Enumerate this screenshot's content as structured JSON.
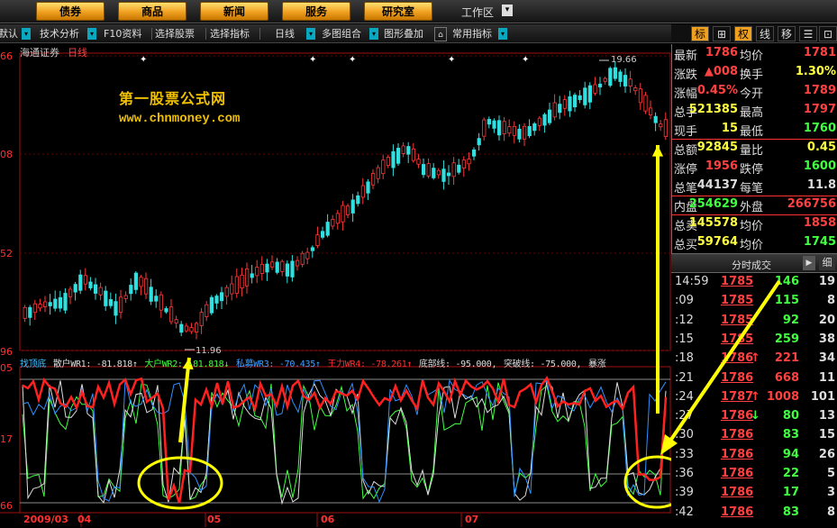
{
  "menu": [
    "债券",
    "商品",
    "新闻",
    "服务",
    "研究室"
  ],
  "workspace": "工作区",
  "workspace_arrow": "▾",
  "toolbar": {
    "left_cut": "默认",
    "tech": "技术分析",
    "f10": "F10资料",
    "choose_stock": "选择股票",
    "choose_indicator": "选择指标",
    "period": "日线",
    "multi": "多图组合",
    "overlay": "图形叠加",
    "common": "常用指标",
    "arrow": "▾"
  },
  "right_tools": [
    "标",
    "⊞",
    "权",
    "线",
    "移",
    "☰",
    "⊡"
  ],
  "chart": {
    "stock_name": "海通证券",
    "period": "日线",
    "watermark_title": "第一股票公式网",
    "watermark_url": "www.chnmoney.com",
    "price_labels": [
      "66",
      "08",
      "52",
      "96"
    ],
    "high_label": "19.66",
    "low_label": "11.96",
    "indicator_vals": [
      "05",
      "17",
      "66"
    ],
    "dates": [
      "2009/03",
      "04",
      "05",
      "06",
      "07"
    ]
  },
  "indicator_legend": [
    {
      "text": "找顶底",
      "color": "#40c0ff"
    },
    {
      "text": "散户WR1: -81.818↑",
      "color": "#dddddd"
    },
    {
      "text": "大户WR2: -81.818↓",
      "color": "#40ff40"
    },
    {
      "text": "私募WR3: -70.435↑",
      "color": "#40a0ff"
    },
    {
      "text": "王力WR4: -78.261↑",
      "color": "#ff3030"
    },
    {
      "text": "底部线: -95.000,",
      "color": "#dddddd"
    },
    {
      "text": "突破线: -75.000,",
      "color": "#dddddd"
    },
    {
      "text": "暴涨",
      "color": "#dddddd"
    }
  ],
  "quote": {
    "rows": [
      {
        "l1": "最新",
        "v1": "1786",
        "c1": "#ff4040",
        "l2": "均价",
        "v2": "1781",
        "c2": "#ff4040"
      },
      {
        "l1": "涨跌",
        "v1": "▲008",
        "c1": "#ff4040",
        "l2": "换手",
        "v2": "1.30%",
        "c2": "#ffff40"
      },
      {
        "l1": "涨幅",
        "v1": "0.45%",
        "c1": "#ff4040",
        "l2": "今开",
        "v2": "1789",
        "c2": "#ff4040"
      },
      {
        "l1": "总手",
        "v1": "521385",
        "c1": "#ffff40",
        "l2": "最高",
        "v2": "1797",
        "c2": "#ff4040"
      },
      {
        "l1": "现手",
        "v1": "15",
        "c1": "#ffff40",
        "l2": "最低",
        "v2": "1760",
        "c2": "#40ff40"
      },
      {
        "l1": "总额",
        "v1": "92845",
        "c1": "#ffff40",
        "l2": "量比",
        "v2": "0.45",
        "c2": "#ffff40"
      },
      {
        "l1": "涨停",
        "v1": "1956",
        "c1": "#ff4040",
        "l2": "跌停",
        "v2": "1600",
        "c2": "#40ff40"
      },
      {
        "l1": "总笔",
        "v1": "44137",
        "c1": "#dddddd",
        "l2": "每笔",
        "v2": "11.8",
        "c2": "#dddddd"
      },
      {
        "l1": "内盘",
        "v1": "254629",
        "c1": "#40ff40",
        "l2": "外盘",
        "v2": "266756",
        "c2": "#ff4040"
      },
      {
        "l1": "总卖",
        "v1": "145578",
        "c1": "#ffff40",
        "l2": "均价",
        "v2": "1858",
        "c2": "#ff4040"
      },
      {
        "l1": "总买",
        "v1": "59764",
        "c1": "#ffff40",
        "l2": "均价",
        "v2": "1745",
        "c2": "#40ff40"
      }
    ]
  },
  "trades_title": "分时成交",
  "trades_play": "▶",
  "trades_detail": "细",
  "trades": [
    {
      "t": "14:59",
      "p": "1785",
      "a": "",
      "ac": "#ff4040",
      "v": "146",
      "vc": "#40ff40",
      "n": "19"
    },
    {
      "t": ":09",
      "p": "1785",
      "a": "",
      "ac": "#ff4040",
      "v": "115",
      "vc": "#40ff40",
      "n": "8"
    },
    {
      "t": ":12",
      "p": "1785",
      "a": "",
      "ac": "#ff4040",
      "v": "92",
      "vc": "#40ff40",
      "n": "20"
    },
    {
      "t": ":15",
      "p": "1785",
      "a": "",
      "ac": "#ff4040",
      "v": "259",
      "vc": "#40ff40",
      "n": "38"
    },
    {
      "t": ":18",
      "p": "1786",
      "a": "↑",
      "ac": "#ff4040",
      "v": "221",
      "vc": "#ff4040",
      "n": "34"
    },
    {
      "t": ":21",
      "p": "1786",
      "a": "",
      "ac": "#ff4040",
      "v": "668",
      "vc": "#ff4040",
      "n": "11"
    },
    {
      "t": ":24",
      "p": "1787",
      "a": "↑",
      "ac": "#ff4040",
      "v": "1008",
      "vc": "#ff4040",
      "n": "101"
    },
    {
      "t": ":27",
      "p": "1786",
      "a": "↓",
      "ac": "#40ff40",
      "v": "80",
      "vc": "#40ff40",
      "n": "13"
    },
    {
      "t": ":30",
      "p": "1786",
      "a": "",
      "ac": "#ff4040",
      "v": "83",
      "vc": "#40ff40",
      "n": "15"
    },
    {
      "t": ":33",
      "p": "1786",
      "a": "",
      "ac": "#ff4040",
      "v": "94",
      "vc": "#40ff40",
      "n": "26"
    },
    {
      "t": ":36",
      "p": "1786",
      "a": "",
      "ac": "#ff4040",
      "v": "22",
      "vc": "#40ff40",
      "n": "5"
    },
    {
      "t": ":39",
      "p": "1786",
      "a": "",
      "ac": "#ff4040",
      "v": "17",
      "vc": "#40ff40",
      "n": "3"
    },
    {
      "t": ":42",
      "p": "1786",
      "a": "",
      "ac": "#ff4040",
      "v": "83",
      "vc": "#40ff40",
      "n": "8"
    }
  ]
}
